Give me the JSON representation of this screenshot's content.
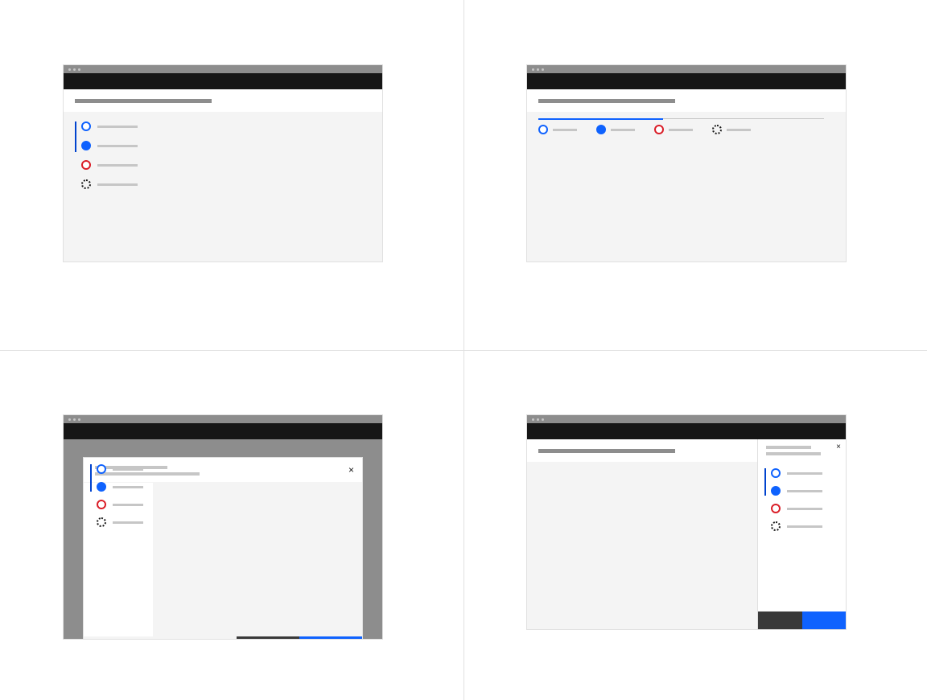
{
  "diagram": {
    "type": "ui-pattern-variants",
    "description": "Four wireframe mockups showing progress indicator step patterns in different container contexts"
  },
  "quadrants": {
    "top_left": {
      "context": "full-page-vertical",
      "header_placeholder": "",
      "steps": [
        {
          "state": "incomplete",
          "style": "outline-blue",
          "label": ""
        },
        {
          "state": "current",
          "style": "filled-blue",
          "label": ""
        },
        {
          "state": "error",
          "style": "outline-red",
          "label": ""
        },
        {
          "state": "disabled",
          "style": "dotted",
          "label": ""
        }
      ]
    },
    "top_right": {
      "context": "full-page-horizontal",
      "header_placeholder": "",
      "steps": [
        {
          "state": "incomplete",
          "style": "outline-blue",
          "label": ""
        },
        {
          "state": "current",
          "style": "filled-blue",
          "label": ""
        },
        {
          "state": "error",
          "style": "outline-red",
          "label": ""
        },
        {
          "state": "disabled",
          "style": "dotted",
          "label": ""
        }
      ]
    },
    "bottom_left": {
      "context": "modal-dialog",
      "modal_title": "",
      "modal_subtitle": "",
      "close_label": "×",
      "link_label": "",
      "secondary_button": "",
      "primary_button": "",
      "steps": [
        {
          "state": "incomplete",
          "style": "outline-blue",
          "label": ""
        },
        {
          "state": "current",
          "style": "filled-blue",
          "label": ""
        },
        {
          "state": "error",
          "style": "outline-red",
          "label": ""
        },
        {
          "state": "disabled",
          "style": "dotted",
          "label": ""
        }
      ]
    },
    "bottom_right": {
      "context": "side-panel",
      "header_placeholder": "",
      "panel_title": "",
      "panel_subtitle": "",
      "close_label": "×",
      "secondary_button": "",
      "primary_button": "",
      "steps": [
        {
          "state": "incomplete",
          "style": "outline-blue",
          "label": ""
        },
        {
          "state": "current",
          "style": "filled-blue",
          "label": ""
        },
        {
          "state": "error",
          "style": "outline-red",
          "label": ""
        },
        {
          "state": "disabled",
          "style": "dotted",
          "label": ""
        }
      ]
    }
  },
  "colors": {
    "primary": "#0f62fe",
    "error": "#da1e28",
    "gray_chrome": "#8d8d8d",
    "black_bar": "#161616",
    "bg_subtle": "#f4f4f4",
    "secondary_btn": "#393939"
  }
}
